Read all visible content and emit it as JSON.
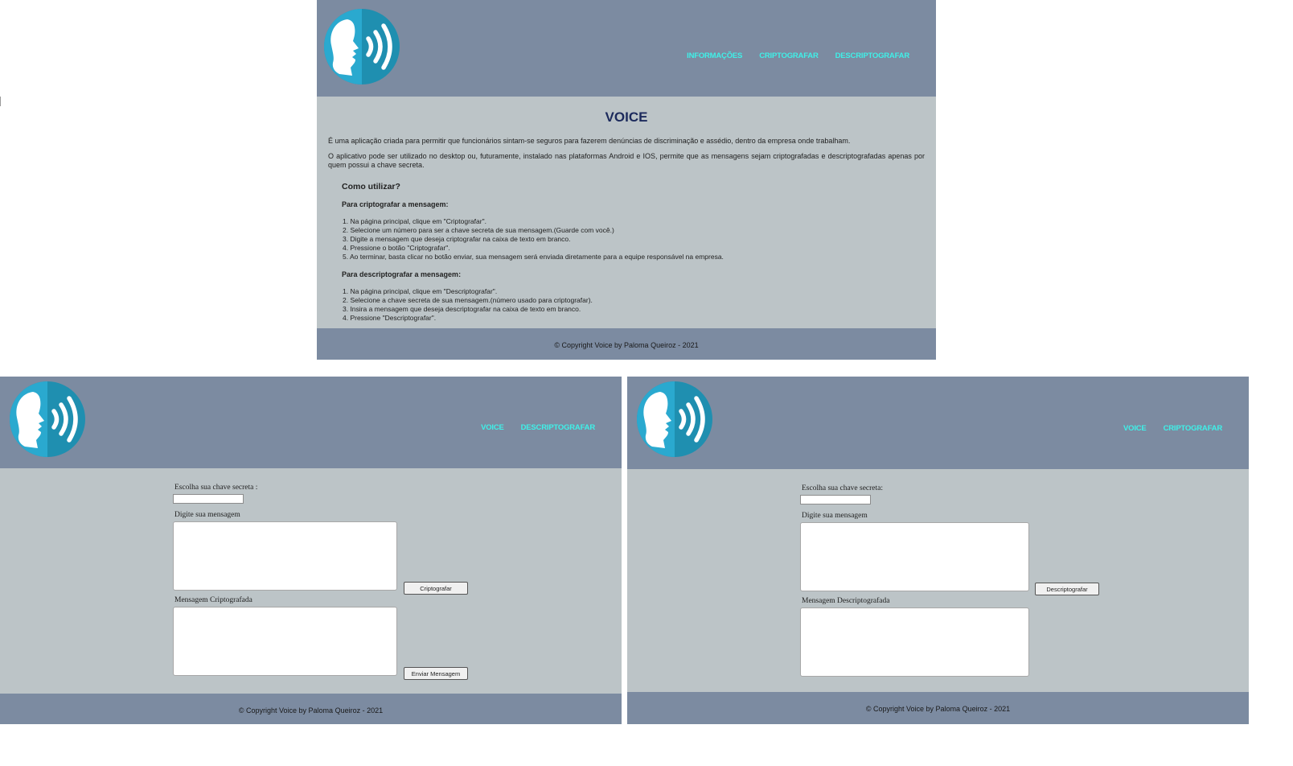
{
  "colors": {
    "header": "#7c8ba1",
    "content": "#bcc4c7",
    "nav_link": "#3ff0e8",
    "title": "#1c2a5c"
  },
  "logo_icon": "speaking-head-icon",
  "info_page": {
    "nav": [
      "INFORMAÇÕES",
      "CRIPTOGRAFAR",
      "DESCRIPTOGRAFAR"
    ],
    "title": "VOICE",
    "paragraph1": "É uma aplicação criada para permitir que funcionários sintam-se seguros para fazerem denúncias de discriminação e assédio, dentro da empresa onde trabalham.",
    "paragraph2": "O aplicativo pode ser utilizado no desktop ou, futuramente, instalado nas plataformas Android e IOS, permite que as mensagens sejam criptografadas e descriptografadas apenas por quem possui a chave secreta.",
    "how_to_heading": "Como utilizar?",
    "encrypt_heading": "Para criptografar a mensagem:",
    "encrypt_steps": [
      "1. Na página principal, clique em \"Criptografar\".",
      "2. Selecione um número para ser a chave secreta de sua mensagem.(Guarde com você.)",
      "3. Digite a mensagem que deseja criptografar na caixa de texto em branco.",
      "4. Pressione o botão \"Criptografar\".",
      "5. Ao terminar, basta clicar no botão enviar, sua mensagem será enviada diretamente para a equipe responsável na empresa."
    ],
    "decrypt_heading": "Para descriptografar a mensagem:",
    "decrypt_steps": [
      "1. Na página principal, clique em \"Descriptografar\".",
      "2. Selecione a chave secreta de sua mensagem.(número usado para criptografar).",
      "3. Insira a mensagem que deseja descriptografar na caixa de texto em branco.",
      "4. Pressione \"Descriptografar\"."
    ],
    "footer": "© Copyright Voice by Paloma Queiroz - 2021"
  },
  "encrypt_page": {
    "nav": [
      "VOICE",
      "DESCRIPTOGRAFAR"
    ],
    "key_label": "Escolha sua chave secreta :",
    "message_label": "Digite sua mensagem",
    "encrypt_button": "Criptografar",
    "result_label": "Mensagem Criptografada",
    "send_button": "Enviar Mensagem",
    "footer": "© Copyright Voice by Paloma Queiroz - 2021"
  },
  "decrypt_page": {
    "nav": [
      "VOICE",
      "CRIPTOGRAFAR"
    ],
    "key_label": "Escolha sua chave secreta:",
    "message_label": "Digite sua mensagem",
    "decrypt_button": "Descriptografar",
    "result_label": "Mensagem Descriptografada",
    "footer": "© Copyright Voice by Paloma Queiroz - 2021"
  }
}
